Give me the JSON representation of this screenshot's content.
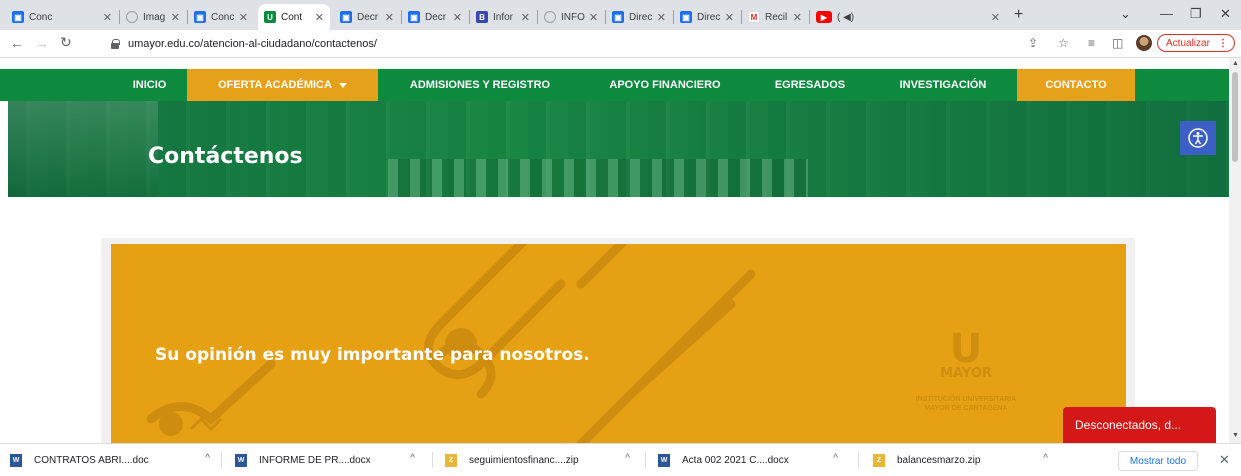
{
  "browser": {
    "tabs": [
      {
        "label": "Conc",
        "icon": "gov-favicon",
        "color": "#1f6feb"
      },
      {
        "label": "Imag",
        "icon": "globe-favicon",
        "color": "#9aa0a6"
      },
      {
        "label": "Conc",
        "icon": "gov-favicon",
        "color": "#1f6feb"
      },
      {
        "label": "Cont",
        "icon": "umayor-favicon",
        "color": "#0e8a3e",
        "active": true
      },
      {
        "label": "Decr",
        "icon": "gov-favicon",
        "color": "#1f6feb"
      },
      {
        "label": "Decr",
        "icon": "gov-favicon",
        "color": "#1f6feb"
      },
      {
        "label": "Infor",
        "icon": "bv-favicon",
        "color": "#3949ab"
      },
      {
        "label": "INFO",
        "icon": "globe-favicon",
        "color": "#9aa0a6"
      },
      {
        "label": "Direc",
        "icon": "gov-favicon",
        "color": "#1f6feb"
      },
      {
        "label": "Direc",
        "icon": "gov-favicon",
        "color": "#1f6feb"
      },
      {
        "label": "Recil",
        "icon": "gmail-favicon",
        "color": "#d93025"
      },
      {
        "label": "( ◀)",
        "icon": "youtube-favicon",
        "color": "#ff0000"
      }
    ],
    "url": "umayor.edu.co/atencion-al-ciudadano/contactenos/",
    "update_label": "Actualizar"
  },
  "nav": {
    "items": [
      "INICIO",
      "OFERTA ACADÉMICA",
      "ADMISIONES Y REGISTRO",
      "APOYO FINANCIERO",
      "EGRESADOS",
      "INVESTIGACIÓN",
      "CONTACTO"
    ]
  },
  "hero": {
    "title": "Contáctenos"
  },
  "banner": {
    "heading": "Su opinión es muy importante para nosotros.",
    "logo_letter": "U",
    "logo_word": "MAYOR",
    "logo_line1": "INSTITUCIÓN UNIVERSITARIA",
    "logo_line2": "MAYOR DE CARTAGENA"
  },
  "chat": {
    "label": "Desconectados, d..."
  },
  "downloads": {
    "items": [
      {
        "name": "CONTRATOS ABRI....doc",
        "type": "word"
      },
      {
        "name": "INFORME DE PR....docx",
        "type": "word"
      },
      {
        "name": "seguimientosfinanc....zip",
        "type": "zip"
      },
      {
        "name": "Acta 002 2021 C....docx",
        "type": "word"
      },
      {
        "name": "balancesmarzo.zip",
        "type": "zip"
      }
    ],
    "show_all": "Mostrar todo"
  },
  "colors": {
    "nav_green": "#0e8a3e",
    "accent_orange": "#e6a11a",
    "banner_orange": "#e5a013",
    "chat_red": "#d41818",
    "a11y_blue": "#3b5fc4"
  }
}
